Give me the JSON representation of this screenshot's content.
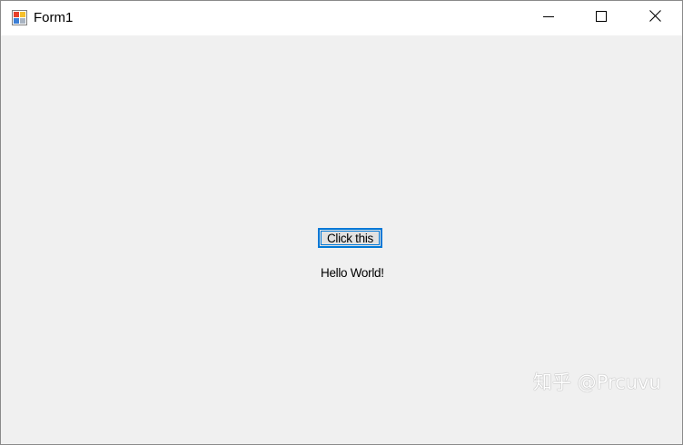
{
  "window": {
    "title": "Form1",
    "icon": "winforms-app-icon",
    "controls": {
      "minimize": "minimize-icon",
      "maximize": "maximize-icon",
      "close": "close-icon"
    }
  },
  "form": {
    "button_label": "Click this",
    "label_text": "Hello World!"
  },
  "watermark": {
    "text": "知乎 @Prcuvu"
  },
  "colors": {
    "client_background": "#f0f0f0",
    "titlebar_background": "#ffffff",
    "focus_accent": "#0078d7"
  }
}
